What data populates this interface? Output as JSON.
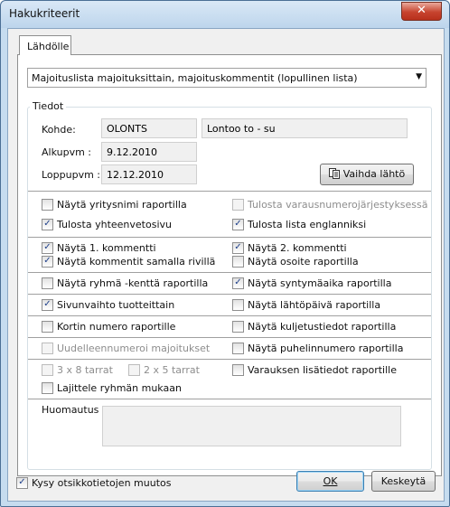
{
  "window": {
    "title": "Hakukriteerit",
    "close_glyph": "✕"
  },
  "tab": {
    "label": "Lähdölle"
  },
  "report_select": {
    "value": "Majoituslista majoituksittain, majoituskommentit (lopullinen lista)",
    "arrow": "▼"
  },
  "tiedot": {
    "legend": "Tiedot",
    "kohde_label": "Kohde:",
    "kohde_code": "OLONTS",
    "kohde_name": "Lontoo to - su",
    "alkupvm_label": "Alkupvm :",
    "alkupvm": "9.12.2010",
    "loppupvm_label": "Loppupvm :",
    "loppupvm": "12.12.2010",
    "vaihda_label": "Vaihda lähtö"
  },
  "options": {
    "yritysnimi": "Näytä yritysnimi raportilla",
    "varausnumero": "Tulosta varausnumerojärjestyksessä",
    "yhteenveto": "Tulosta yhteenvetosivu",
    "englanniksi": "Tulosta lista englanniksi",
    "kommentti1": "Näytä 1. kommentti",
    "kommentti2": "Näytä 2. kommentti",
    "kommentit_samalla": "Näytä kommentit samalla rivillä",
    "osoite": "Näytä osoite raportilla",
    "ryhma_kentta": "Näytä ryhmä -kenttä raportilla",
    "syntymaaika": "Näytä syntymäaika raportilla",
    "sivunvaihto": "Sivunvaihto tuotteittain",
    "lahtopaiva": "Näytä lähtöpäivä raportilla",
    "kortin_numero": "Kortin numero raportille",
    "kuljetustiedot": "Näytä kuljetustiedot raportilla",
    "uudelleennumeroi": "Uudelleennumeroi majoitukset",
    "puhelinnumero": "Näytä puhelinnumero raportilla",
    "tarrat_3x8": "3 x 8 tarrat",
    "tarrat_2x5": "2 x 5 tarrat",
    "lisatiedot": "Varauksen lisätiedot raportille",
    "lajittele": "Lajittele ryhmän mukaan"
  },
  "huomautus_label": "Huomautus :",
  "kysy_label": "Kysy otsikkotietojen muutos",
  "buttons": {
    "ok": "OK",
    "cancel": "Keskeytä"
  },
  "check_glyph": "✓"
}
